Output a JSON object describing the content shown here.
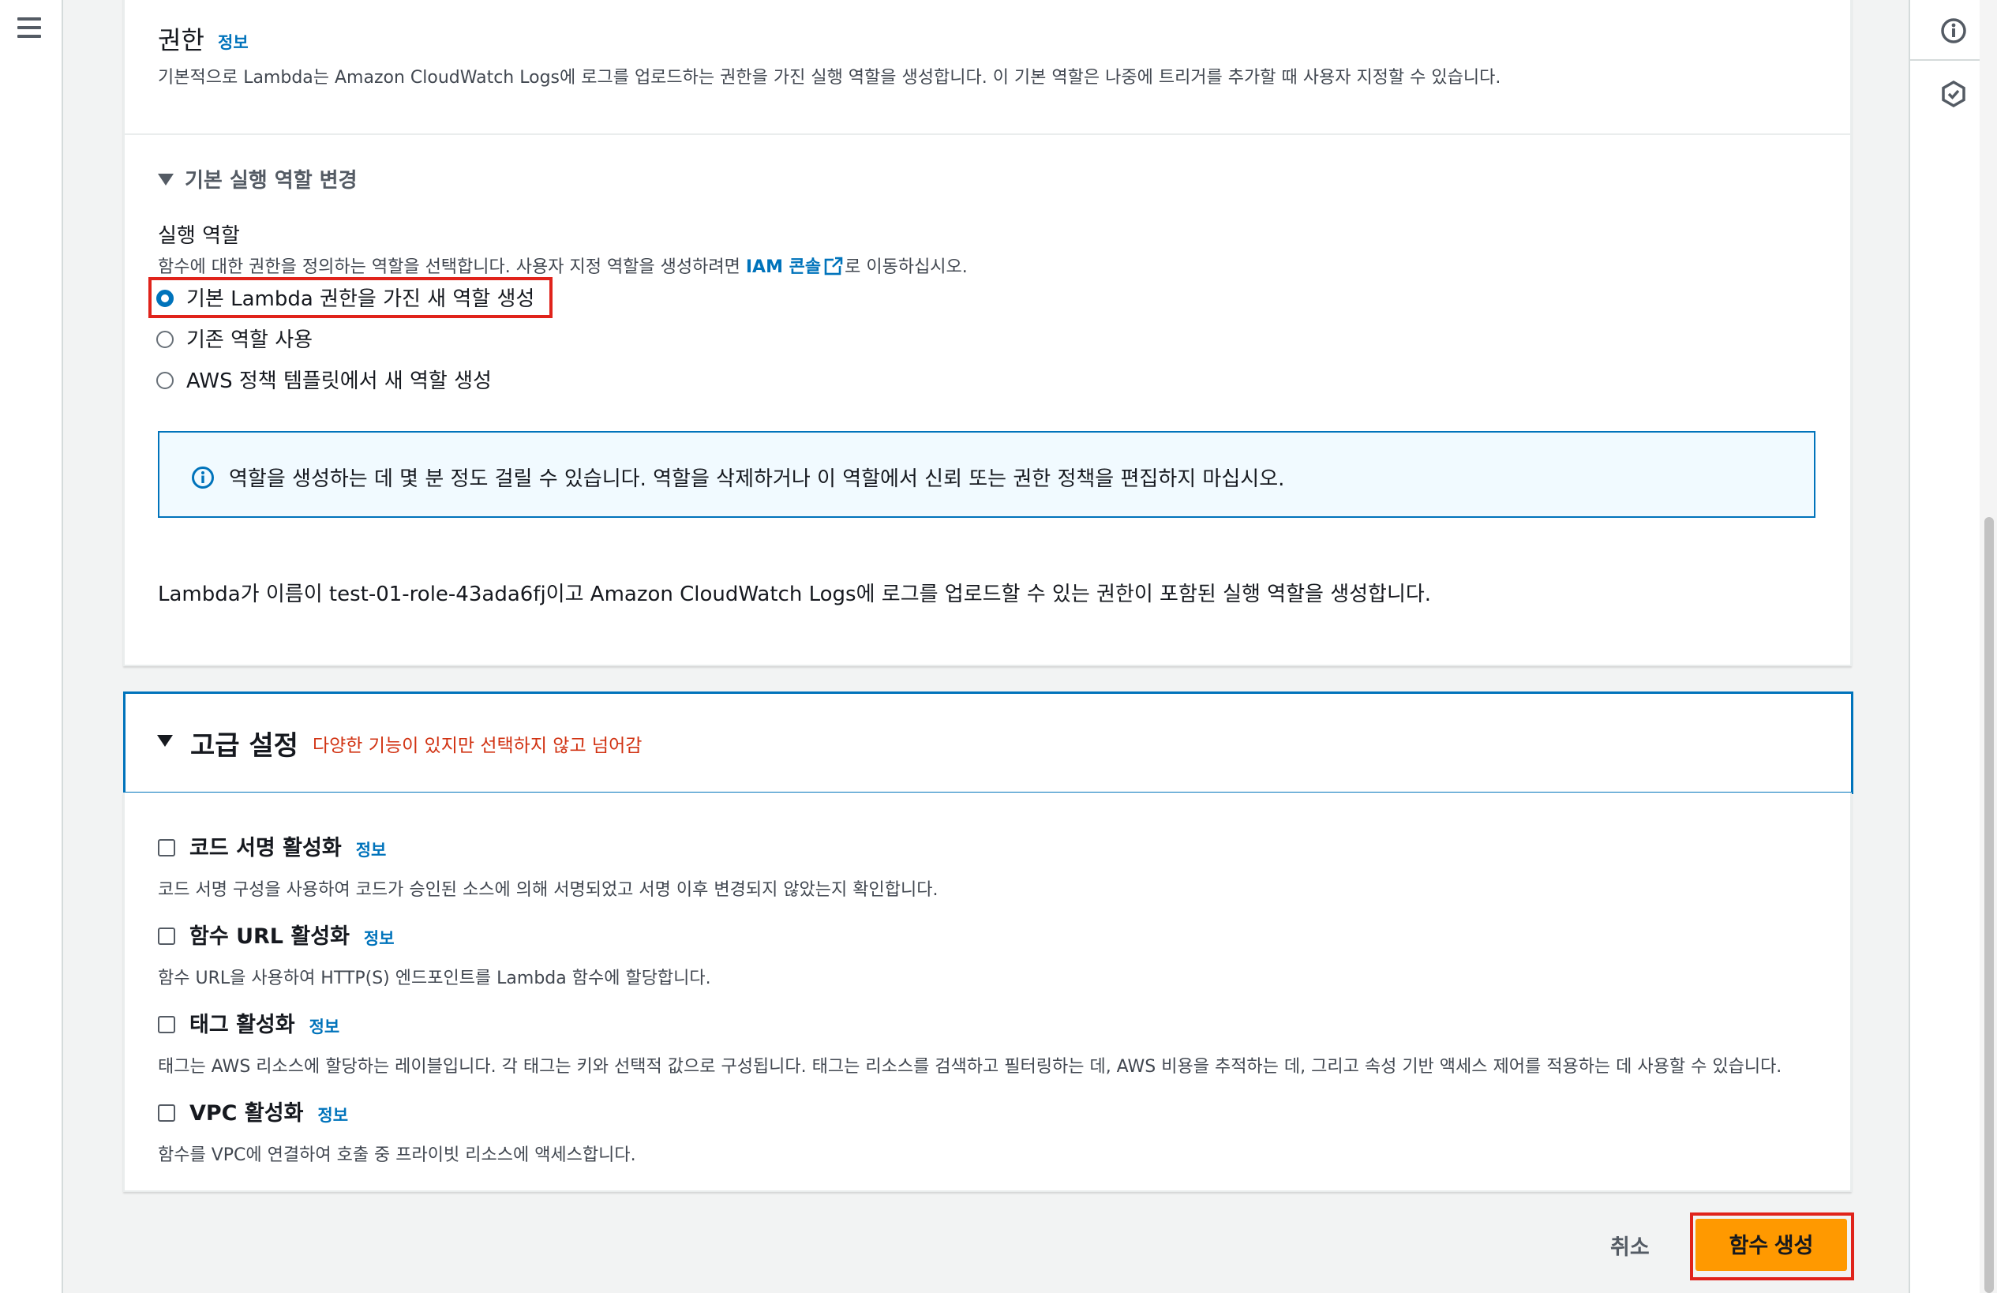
{
  "permissions": {
    "title": "권한",
    "info": "정보",
    "description": "기본적으로 Lambda는 Amazon CloudWatch Logs에 로그를 업로드하는 권한을 가진 실행 역할을 생성합니다. 이 기본 역할은 나중에 트리거를 추가할 때 사용자 지정할 수 있습니다.",
    "expand_label": "기본 실행 역할 변경",
    "role_label": "실행 역할",
    "role_desc_before": "함수에 대한 권한을 정의하는 역할을 선택합니다. 사용자 지정 역할을 생성하려면",
    "iam_link": "IAM 콘솔",
    "role_desc_after": "로 이동하십시오.",
    "options": [
      {
        "label": "기본 Lambda 권한을 가진 새 역할 생성",
        "checked": true
      },
      {
        "label": "기존 역할 사용",
        "checked": false
      },
      {
        "label": "AWS 정책 템플릿에서 새 역할 생성",
        "checked": false
      }
    ],
    "alert": "역할을 생성하는 데 몇 분 정도 걸릴 수 있습니다. 역할을 삭제하거나 이 역할에서 신뢰 또는 권한 정책을 편집하지 마십시오.",
    "summary": "Lambda가 이름이 test-01-role-43ada6fj이고 Amazon CloudWatch Logs에 로그를 업로드할 수 있는 권한이 포함된 실행 역할을 생성합니다."
  },
  "advanced": {
    "title": "고급 설정",
    "note": "다양한 기능이 있지만 선택하지 않고 넘어감",
    "options": [
      {
        "label": "코드 서명 활성화",
        "info": "정보",
        "desc": "코드 서명 구성을 사용하여 코드가 승인된 소스에 의해 서명되었고 서명 이후 변경되지 않았는지 확인합니다.",
        "checked": false
      },
      {
        "label": "함수 URL 활성화",
        "info": "정보",
        "desc": "함수 URL을 사용하여 HTTP(S) 엔드포인트를 Lambda 함수에 할당합니다.",
        "checked": false
      },
      {
        "label": "태그 활성화",
        "info": "정보",
        "desc": "태그는 AWS 리소스에 할당하는 레이블입니다. 각 태그는 키와 선택적 값으로 구성됩니다. 태그는 리소스를 검색하고 필터링하는 데, AWS 비용을 추적하는 데, 그리고 속성 기반 액세스 제어를 적용하는 데 사용할 수 있습니다.",
        "checked": false
      },
      {
        "label": "VPC 활성화",
        "info": "정보",
        "desc": "함수를 VPC에 연결하여 호출 중 프라이빗 리소스에 액세스합니다.",
        "checked": false
      }
    ]
  },
  "footer": {
    "cancel": "취소",
    "create": "함수 생성"
  },
  "icons": {
    "menu": "hamburger-menu-icon",
    "info_panel": "info-circle-icon",
    "security": "shield-hexagon-icon",
    "external_link": "external-link-icon",
    "alert_info": "info-circle-icon"
  },
  "colors": {
    "accent": "#0073bb",
    "primary_button": "#ff9900",
    "highlight_box": "#e0231b",
    "note_text": "#d13212"
  }
}
